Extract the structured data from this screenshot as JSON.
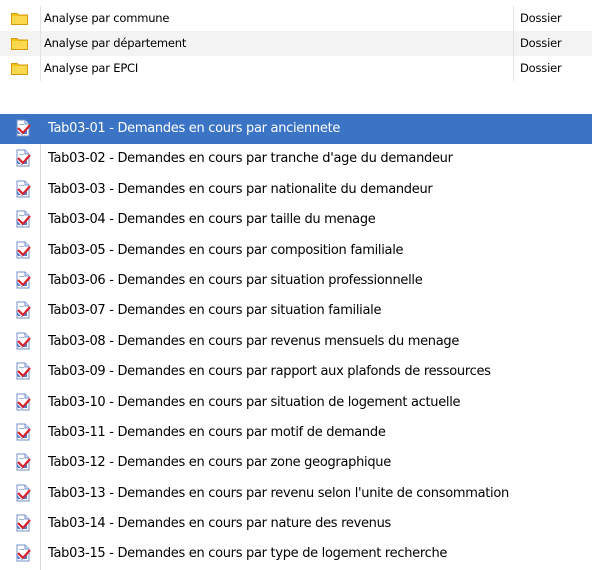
{
  "folders": [
    {
      "name": "Analyse par commune",
      "type": "Dossier",
      "icon": "folder-icon"
    },
    {
      "name": "Analyse par département",
      "type": "Dossier",
      "icon": "folder-icon"
    },
    {
      "name": "Analyse par EPCI",
      "type": "Dossier",
      "icon": "folder-icon"
    }
  ],
  "reports": [
    {
      "title": "Tab03-01 - Demandes en cours par anciennete",
      "icon": "report-document-icon",
      "selected": true
    },
    {
      "title": "Tab03-02 - Demandes en cours par tranche d'age du demandeur",
      "icon": "report-document-icon"
    },
    {
      "title": "Tab03-03 - Demandes en cours par nationalite du demandeur",
      "icon": "report-document-icon"
    },
    {
      "title": "Tab03-04 - Demandes en cours par taille du menage",
      "icon": "report-document-icon"
    },
    {
      "title": "Tab03-05 - Demandes en cours par composition familiale",
      "icon": "report-document-icon"
    },
    {
      "title": "Tab03-06 - Demandes en cours par situation professionnelle",
      "icon": "report-document-icon"
    },
    {
      "title": "Tab03-07 - Demandes en cours par situation familiale",
      "icon": "report-document-icon"
    },
    {
      "title": "Tab03-08 - Demandes en cours par revenus mensuels du menage",
      "icon": "report-document-icon"
    },
    {
      "title": "Tab03-09 - Demandes en cours par rapport aux plafonds de ressources",
      "icon": "report-document-icon"
    },
    {
      "title": "Tab03-10 - Demandes en cours par situation de logement actuelle",
      "icon": "report-document-icon"
    },
    {
      "title": "Tab03-11 - Demandes en cours par motif de demande",
      "icon": "report-document-icon"
    },
    {
      "title": "Tab03-12 - Demandes en cours par zone geographique",
      "icon": "report-document-icon"
    },
    {
      "title": "Tab03-13 - Demandes en cours par revenu selon l'unite de consommation",
      "icon": "report-document-icon"
    },
    {
      "title": "Tab03-14 - Demandes en cours par nature des revenus",
      "icon": "report-document-icon"
    },
    {
      "title": "Tab03-15 - Demandes en cours par type de logement recherche",
      "icon": "report-document-icon"
    }
  ],
  "colors": {
    "selection": "#3b73c5",
    "folder": "#f5c518",
    "report_icon_blue": "#3a63c6",
    "report_icon_red": "#d8202a"
  }
}
